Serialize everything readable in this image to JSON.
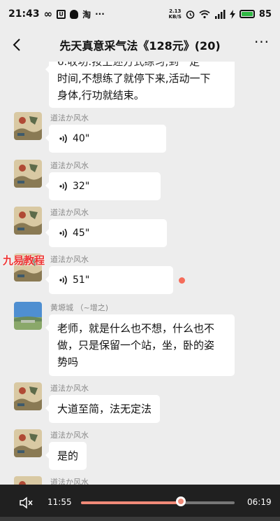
{
  "status_bar": {
    "time": "21:43",
    "icons": [
      "infinity-icon",
      "app-box-icon",
      "qq-icon",
      "taobao-icon",
      "more-dots-icon"
    ],
    "taobao_glyph": "淘",
    "net_speed_value": "2.13",
    "net_speed_unit": "KB/S",
    "battery": "85"
  },
  "header": {
    "title": "先天真意采气法《128元》(20)"
  },
  "messages": [
    {
      "type": "text",
      "text_line1": "6.收功:按上述方式练习,到一定",
      "text_line2": "时间,不想练了就停下来,活动一下",
      "text_line3": "身体,行功就结束。"
    },
    {
      "type": "voice",
      "sender": "道法か风水",
      "duration": "40\""
    },
    {
      "type": "voice",
      "sender": "道法か风水",
      "duration": "32\""
    },
    {
      "type": "voice",
      "sender": "道法か风水",
      "duration": "45\""
    },
    {
      "type": "voice",
      "sender": "道法か风水",
      "duration": "51\"",
      "unread": true
    },
    {
      "type": "text",
      "sender": "黄塬城 （~增之)",
      "text_line1": "老师，就是什么也不想，什么也不",
      "text_line2": "做，只是保留一个站，坐，卧的姿",
      "text_line3": "势吗"
    },
    {
      "type": "text",
      "sender": "道法か风水",
      "text_line1": "大道至简，法无定法"
    },
    {
      "type": "text",
      "sender": "道法か风水",
      "text_line1": "是的"
    },
    {
      "type": "text",
      "sender": "道法か风水"
    }
  ],
  "watermark": "九易教程",
  "player": {
    "current_time": "11:55",
    "total_time": "06:19",
    "progress": 0.65
  },
  "colors": {
    "background": "#ededed",
    "bubble": "#ffffff",
    "unread": "#f56c5a",
    "progress": "#f08a78",
    "player_bg": "#202020"
  }
}
